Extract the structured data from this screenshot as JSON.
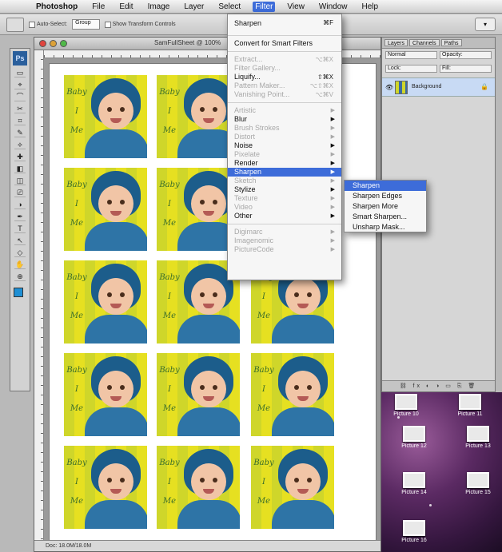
{
  "menubar": {
    "apple": "",
    "items": [
      "Photoshop",
      "File",
      "Edit",
      "Image",
      "Layer",
      "Select",
      "Filter",
      "View",
      "Window",
      "Help"
    ]
  },
  "options_bar": {
    "auto_select_label": "Auto-Select:",
    "auto_select_value": "Group",
    "show_transform_label": "Show Transform Controls"
  },
  "tools": {
    "logo": "Ps",
    "glyphs": [
      "▭",
      "⌖",
      "⌒",
      "✂",
      "⌗",
      "✎",
      "⟡",
      "✚",
      "◧",
      "◫",
      "⎚",
      "◑",
      "✒",
      "T",
      "↖",
      "◇",
      "✋",
      "⊕"
    ]
  },
  "document": {
    "title": "SamFullSheet @ 100%",
    "status": "Doc: 18.0M/18.0M"
  },
  "photo_tiles": {
    "script_lines": [
      "Baby",
      "I",
      "Me"
    ]
  },
  "filter_menu": {
    "items": [
      {
        "label": "Sharpen",
        "shortcut": "⌘F",
        "state": "normal",
        "submenu": false,
        "first": true
      },
      {
        "sep": true
      },
      {
        "label": "Convert for Smart Filters",
        "shortcut": "",
        "state": "normal",
        "submenu": false
      },
      {
        "sep": true
      },
      {
        "label": "Extract...",
        "shortcut": "⌥⌘X",
        "state": "dim",
        "submenu": false
      },
      {
        "label": "Filter Gallery...",
        "shortcut": "",
        "state": "dim",
        "submenu": false
      },
      {
        "label": "Liquify...",
        "shortcut": "⇧⌘X",
        "state": "normal",
        "submenu": false
      },
      {
        "label": "Pattern Maker...",
        "shortcut": "⌥⇧⌘X",
        "state": "dim",
        "submenu": false
      },
      {
        "label": "Vanishing Point...",
        "shortcut": "⌥⌘V",
        "state": "dim",
        "submenu": false
      },
      {
        "sep": true
      },
      {
        "label": "Artistic",
        "state": "dim",
        "submenu": true
      },
      {
        "label": "Blur",
        "state": "normal",
        "submenu": true
      },
      {
        "label": "Brush Strokes",
        "state": "dim",
        "submenu": true
      },
      {
        "label": "Distort",
        "state": "dim",
        "submenu": true
      },
      {
        "label": "Noise",
        "state": "normal",
        "submenu": true
      },
      {
        "label": "Pixelate",
        "state": "dim",
        "submenu": true
      },
      {
        "label": "Render",
        "state": "normal",
        "submenu": true
      },
      {
        "label": "Sharpen",
        "state": "highlight",
        "submenu": true
      },
      {
        "label": "Sketch",
        "state": "dim",
        "submenu": true
      },
      {
        "label": "Stylize",
        "state": "normal",
        "submenu": true
      },
      {
        "label": "Texture",
        "state": "dim",
        "submenu": true
      },
      {
        "label": "Video",
        "state": "dim",
        "submenu": true
      },
      {
        "label": "Other",
        "state": "normal",
        "submenu": true
      },
      {
        "sep": true
      },
      {
        "label": "Digimarc",
        "state": "dim",
        "submenu": true
      },
      {
        "label": "Imagenomic",
        "state": "dim",
        "submenu": true
      },
      {
        "label": "PictureCode",
        "state": "dim",
        "submenu": true
      }
    ]
  },
  "sharpen_submenu": {
    "items": [
      "Sharpen",
      "Sharpen Edges",
      "Sharpen More",
      "Smart Sharpen...",
      "Unsharp Mask..."
    ],
    "highlighted_index": 0
  },
  "layers_panel": {
    "tabs": [
      "Layers",
      "Channels",
      "Paths"
    ],
    "blend_mode": "Normal",
    "opacity_label": "Opacity:",
    "fill_label": "Fill:",
    "lock_label": "Lock:",
    "layer_name": "Background",
    "lock_icon": "🔒",
    "bottom_icons": "⛓ fx ◐ ◑ ▭ ⎘ 🗑"
  },
  "desktop": {
    "icons": [
      "Picture 10",
      "Picture 11",
      "Picture 12",
      "Picture 13",
      "Picture 14",
      "Picture 15",
      "Picture 16"
    ]
  },
  "colors": {
    "menu_highlight": "#3d6cd9",
    "foreground_swatch": "#1e8fd4",
    "photo_yellow": "#e6e021",
    "hat_blue": "#1c5d8b"
  }
}
